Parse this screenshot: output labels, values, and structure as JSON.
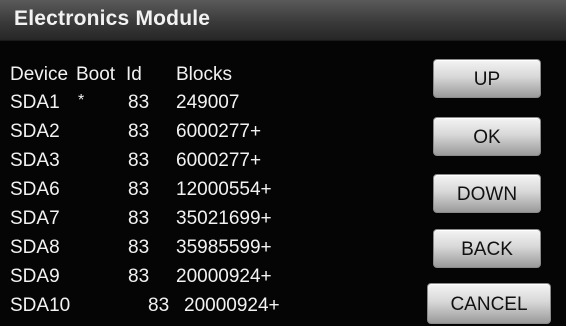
{
  "window": {
    "title": "Electronics Module"
  },
  "table": {
    "headers": {
      "device": "Device",
      "boot": "Boot",
      "id": "Id",
      "blocks": "Blocks"
    },
    "rows": [
      {
        "device": "SDA1",
        "boot": "*",
        "id": "83",
        "blocks": "249007"
      },
      {
        "device": "SDA2",
        "boot": "",
        "id": "83",
        "blocks": "6000277+"
      },
      {
        "device": "SDA3",
        "boot": "",
        "id": "83",
        "blocks": "6000277+"
      },
      {
        "device": "SDA6",
        "boot": "",
        "id": "83",
        "blocks": "12000554+"
      },
      {
        "device": "SDA7",
        "boot": "",
        "id": "83",
        "blocks": "35021699+"
      },
      {
        "device": "SDA8",
        "boot": "",
        "id": "83",
        "blocks": "35985599+"
      },
      {
        "device": "SDA9",
        "boot": "",
        "id": "83",
        "blocks": "20000924+"
      },
      {
        "device": "SDA10",
        "boot": "",
        "id": "83",
        "blocks": "20000924+"
      }
    ]
  },
  "buttons": {
    "up": "UP",
    "ok": "OK",
    "down": "DOWN",
    "back": "BACK",
    "cancel": "CANCEL"
  }
}
